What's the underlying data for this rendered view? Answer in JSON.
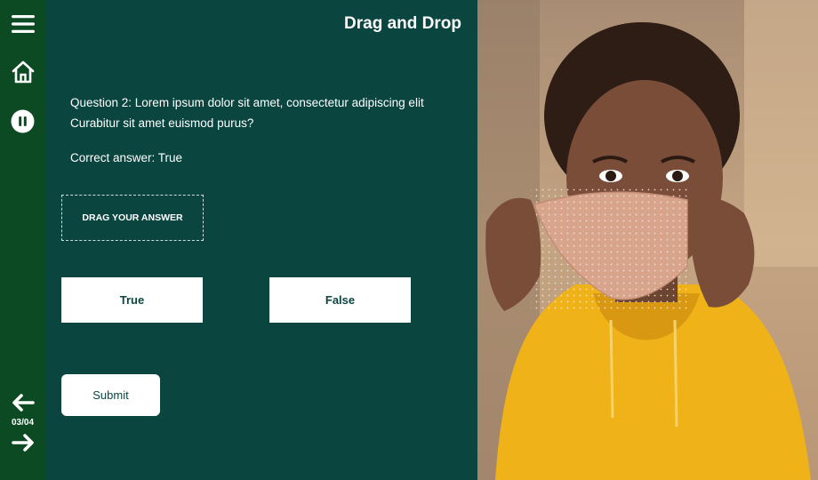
{
  "header": {
    "title": "Drag and Drop"
  },
  "question": {
    "line1": "Question 2: Lorem ipsum dolor sit amet, consectetur adipiscing elit",
    "line2": "Curabitur sit amet euismod purus?",
    "correct_answer": "Correct answer: True"
  },
  "dropzone": {
    "label": "DRAG YOUR ANSWER"
  },
  "options": [
    {
      "label": "True"
    },
    {
      "label": "False"
    }
  ],
  "submit": {
    "label": "Submit"
  },
  "nav": {
    "counter": "03/04"
  },
  "icons": {
    "menu": "hamburger-menu-icon",
    "home": "home-icon",
    "pause": "pause-icon",
    "prev": "arrow-left-icon",
    "next": "arrow-right-icon"
  },
  "colors": {
    "sidebar": "#0b4a22",
    "main": "#0a4540",
    "hoodie": "#f0b219",
    "mask": "#d9a48c"
  }
}
